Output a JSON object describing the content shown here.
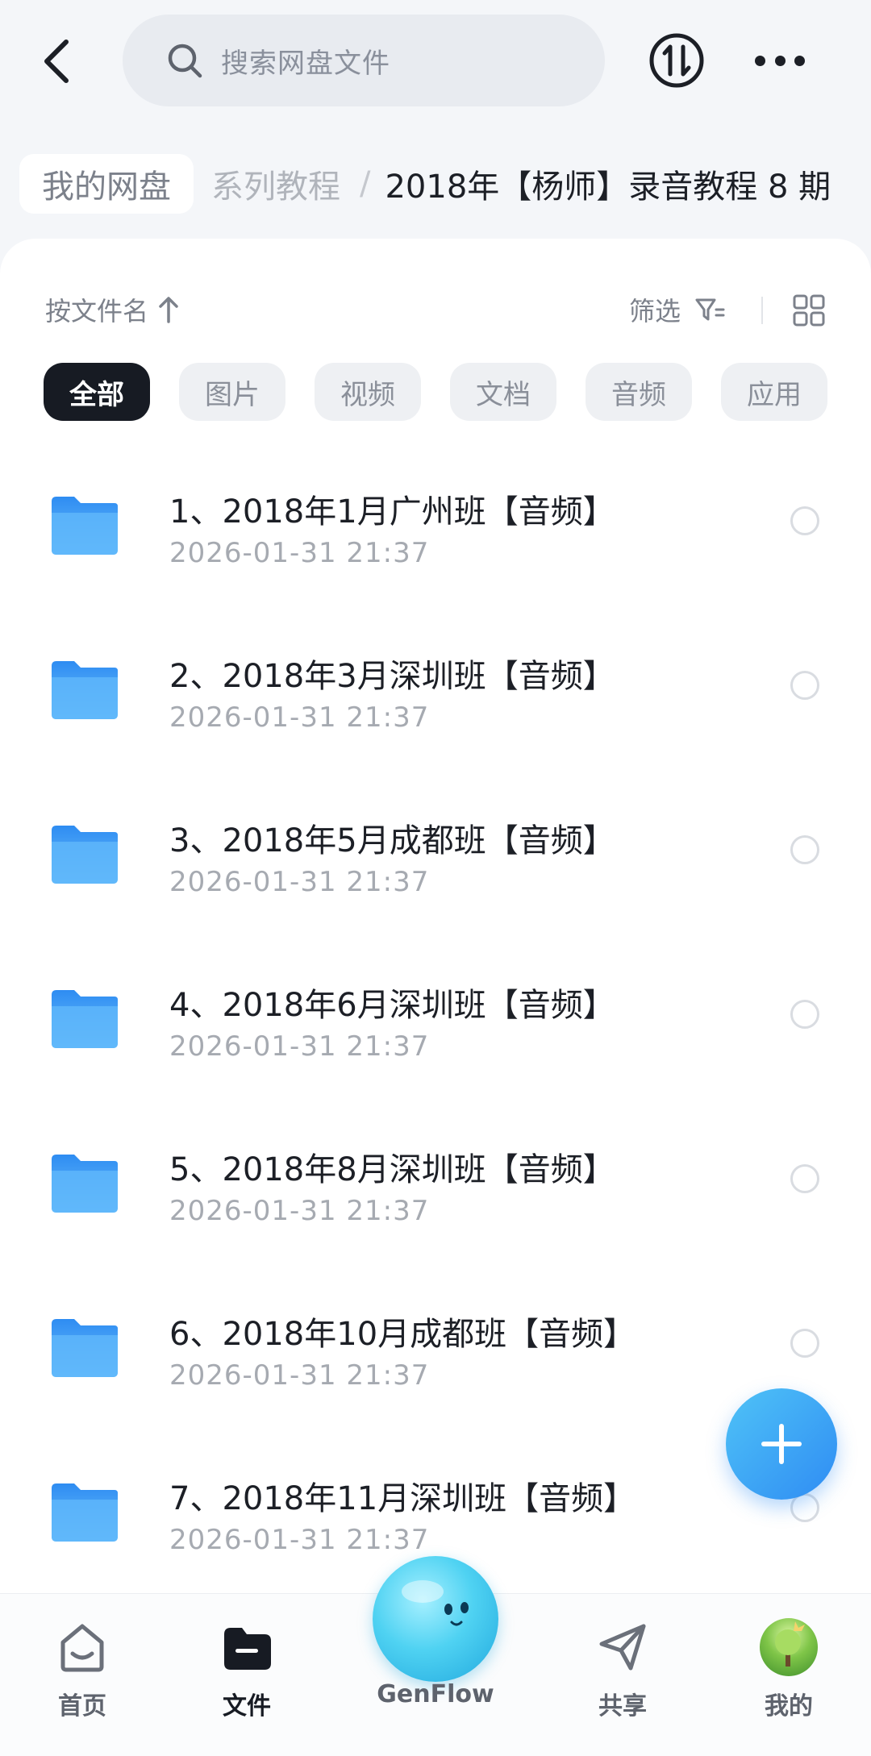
{
  "search": {
    "placeholder": "搜索网盘文件"
  },
  "breadcrumb": {
    "root": "我的网盘",
    "middle": "系列教程",
    "separator": "/",
    "current": "2018年【杨师】录音教程 8 期"
  },
  "sortbar": {
    "sort_label": "按文件名",
    "filter_label": "筛选"
  },
  "chips": [
    {
      "label": "全部",
      "active": true
    },
    {
      "label": "图片",
      "active": false
    },
    {
      "label": "视频",
      "active": false
    },
    {
      "label": "文档",
      "active": false
    },
    {
      "label": "音频",
      "active": false
    },
    {
      "label": "应用",
      "active": false
    }
  ],
  "files": [
    {
      "name": "1、2018年1月广州班【音频】",
      "date": "2026-01-31  21:37"
    },
    {
      "name": "2、2018年3月深圳班【音频】",
      "date": "2026-01-31  21:37"
    },
    {
      "name": "3、2018年5月成都班【音频】",
      "date": "2026-01-31  21:37"
    },
    {
      "name": "4、2018年6月深圳班【音频】",
      "date": "2026-01-31  21:37"
    },
    {
      "name": "5、2018年8月深圳班【音频】",
      "date": "2026-01-31  21:37"
    },
    {
      "name": "6、2018年10月成都班【音频】",
      "date": "2026-01-31  21:37"
    },
    {
      "name": "7、2018年11月深圳班【音频】",
      "date": "2026-01-31  21:37"
    }
  ],
  "bottom_nav": {
    "home": "首页",
    "files": "文件",
    "genflow": "GenFlow",
    "share": "共享",
    "mine": "我的"
  },
  "colors": {
    "accent": "#2f8cf3",
    "folder": "#4aa8f8",
    "active_chip": "#171b23"
  },
  "icons": {
    "back": "chevron-left-icon",
    "search": "search-icon",
    "transfer": "transfer-icon",
    "more": "more-icon",
    "sort": "arrow-up-icon",
    "filter": "filter-icon",
    "grid": "grid-view-icon",
    "folder": "folder-icon",
    "fab": "plus-icon"
  }
}
